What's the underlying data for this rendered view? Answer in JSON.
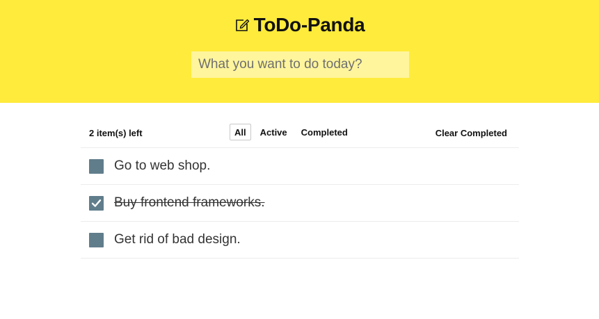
{
  "header": {
    "title": "ToDo-Panda",
    "logo_icon": "edit-icon",
    "background": "#ffeb3b",
    "input_placeholder": "What you want to do today?",
    "input_value": ""
  },
  "toolbar": {
    "count_label": "2 item(s) left",
    "filters": [
      {
        "label": "All",
        "selected": true
      },
      {
        "label": "Active",
        "selected": false
      },
      {
        "label": "Completed",
        "selected": false
      }
    ],
    "clear_label": "Clear Completed"
  },
  "todos": [
    {
      "label": "Go to web shop.",
      "completed": false
    },
    {
      "label": "Buy frontend frameworks.",
      "completed": true
    },
    {
      "label": "Get rid of bad design.",
      "completed": false
    }
  ],
  "colors": {
    "accent": "#ffeb3b",
    "input_bg": "#fff59d",
    "checkbox": "#607d8b"
  }
}
